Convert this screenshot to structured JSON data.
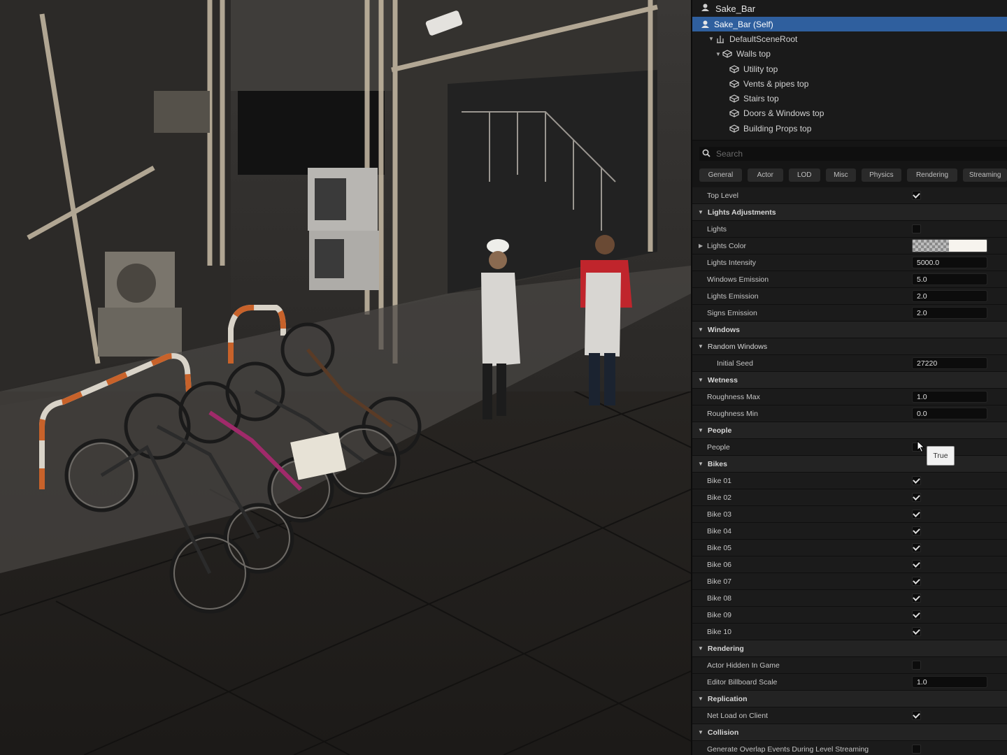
{
  "outliner": {
    "actor_title": "Sake_Bar",
    "rows": [
      {
        "label": "Sake_Bar (Self)",
        "selected": true,
        "icon": "actor-icon",
        "depth": 0
      },
      {
        "label": "DefaultSceneRoot",
        "icon": "scene-root-icon",
        "depth": 1,
        "expanded": true
      },
      {
        "label": "Walls top",
        "icon": "cube-icon",
        "depth": 2,
        "expanded": true
      },
      {
        "label": "Utility top",
        "icon": "cube-icon",
        "depth": 3
      },
      {
        "label": "Vents & pipes top",
        "icon": "cube-icon",
        "depth": 3
      },
      {
        "label": "Stairs top",
        "icon": "cube-icon",
        "depth": 3
      },
      {
        "label": "Doors & Windows top",
        "icon": "cube-icon",
        "depth": 3
      },
      {
        "label": "Building Props top",
        "icon": "cube-icon",
        "depth": 3
      }
    ]
  },
  "search": {
    "placeholder": "Search"
  },
  "tabs": [
    "General",
    "Actor",
    "LOD",
    "Misc",
    "Physics",
    "Rendering",
    "Streaming"
  ],
  "properties": [
    {
      "kind": "prop",
      "label": "Top Level",
      "type": "check",
      "value": true
    },
    {
      "kind": "cat",
      "label": "Lights Adjustments"
    },
    {
      "kind": "prop",
      "label": "Lights",
      "type": "check",
      "value": false
    },
    {
      "kind": "prop",
      "label": "Lights Color",
      "type": "color",
      "expandable": true
    },
    {
      "kind": "prop",
      "label": "Lights Intensity",
      "type": "num",
      "value": "5000.0"
    },
    {
      "kind": "prop",
      "label": "Windows Emission",
      "type": "num",
      "value": "5.0"
    },
    {
      "kind": "prop",
      "label": "Lights Emission",
      "type": "num",
      "value": "2.0"
    },
    {
      "kind": "prop",
      "label": "Signs Emission",
      "type": "num",
      "value": "2.0"
    },
    {
      "kind": "cat",
      "label": "Windows"
    },
    {
      "kind": "cat",
      "label": "Random Windows",
      "sub": true
    },
    {
      "kind": "prop",
      "label": "Initial Seed",
      "type": "num",
      "value": "27220",
      "indent": 2
    },
    {
      "kind": "cat",
      "label": "Wetness"
    },
    {
      "kind": "prop",
      "label": "Roughness Max",
      "type": "num",
      "value": "1.0"
    },
    {
      "kind": "prop",
      "label": "Roughness Min",
      "type": "num",
      "value": "0.0"
    },
    {
      "kind": "cat",
      "label": "People"
    },
    {
      "kind": "prop",
      "label": "People",
      "type": "check",
      "value": false
    },
    {
      "kind": "cat",
      "label": "Bikes"
    },
    {
      "kind": "prop",
      "label": "Bike 01",
      "type": "check",
      "value": true
    },
    {
      "kind": "prop",
      "label": "Bike 02",
      "type": "check",
      "value": true
    },
    {
      "kind": "prop",
      "label": "Bike 03",
      "type": "check",
      "value": true
    },
    {
      "kind": "prop",
      "label": "Bike 04",
      "type": "check",
      "value": true
    },
    {
      "kind": "prop",
      "label": "Bike 05",
      "type": "check",
      "value": true
    },
    {
      "kind": "prop",
      "label": "Bike 06",
      "type": "check",
      "value": true
    },
    {
      "kind": "prop",
      "label": "Bike 07",
      "type": "check",
      "value": true
    },
    {
      "kind": "prop",
      "label": "Bike 08",
      "type": "check",
      "value": true
    },
    {
      "kind": "prop",
      "label": "Bike 09",
      "type": "check",
      "value": true
    },
    {
      "kind": "prop",
      "label": "Bike 10",
      "type": "check",
      "value": true
    },
    {
      "kind": "cat",
      "label": "Rendering"
    },
    {
      "kind": "prop",
      "label": "Actor Hidden In Game",
      "type": "check",
      "value": false
    },
    {
      "kind": "prop",
      "label": "Editor Billboard Scale",
      "type": "num",
      "value": "1.0"
    },
    {
      "kind": "cat",
      "label": "Replication"
    },
    {
      "kind": "prop",
      "label": "Net Load on Client",
      "type": "check",
      "value": true
    },
    {
      "kind": "cat",
      "label": "Collision"
    },
    {
      "kind": "prop",
      "label": "Generate Overlap Events During Level Streaming",
      "type": "check",
      "value": false
    }
  ],
  "tooltip": {
    "text": "True"
  },
  "colors": {
    "selection": "#2f5f9e",
    "panel_bg": "#151515",
    "row_bg": "#1b1b1b",
    "category_bg": "#232323"
  }
}
